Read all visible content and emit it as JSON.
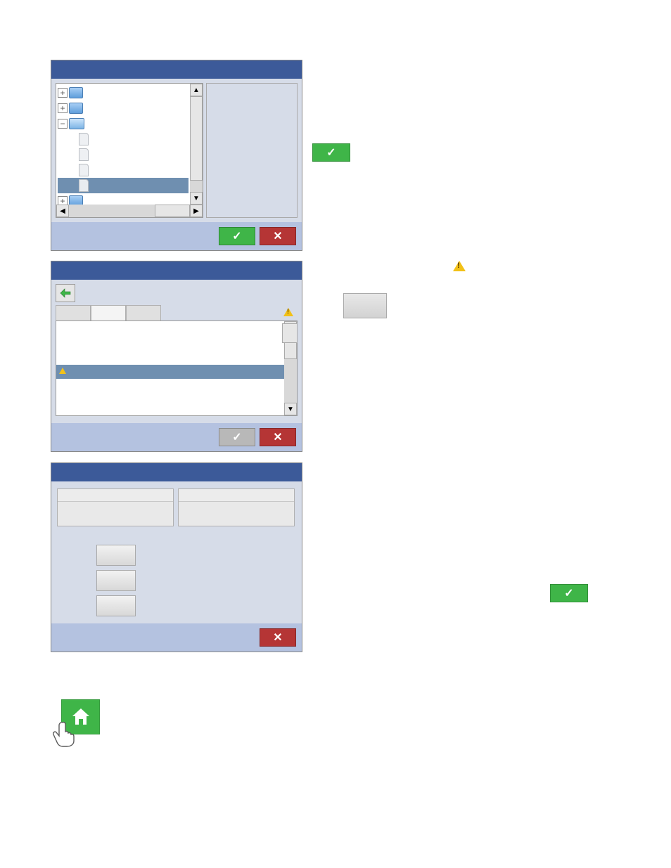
{
  "dlg1": {
    "title": "",
    "ok_label": "✓",
    "cancel_label": "✕"
  },
  "dlg2": {
    "title": "",
    "ok_label": "✓",
    "cancel_label": "✕"
  },
  "dlg3": {
    "title": "",
    "cancel_label": "✕"
  },
  "mini_ok_1": "✓",
  "mini_ok_2": "✓",
  "icons": {
    "expand": "+",
    "collapse": "−",
    "up": "▲",
    "down": "▼",
    "left": "◀",
    "right": "▶",
    "back": "⬅"
  }
}
